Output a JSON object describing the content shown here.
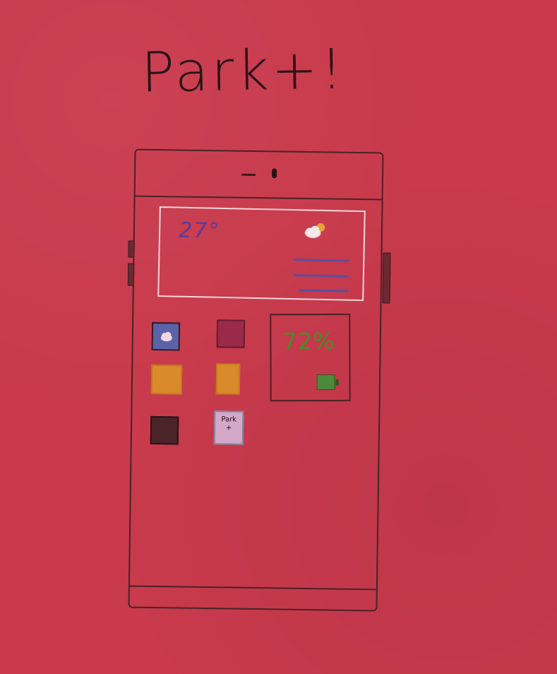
{
  "title": "Park+!",
  "colors": {
    "background": "#c83a4c",
    "ink": "#2a1418",
    "weather_border": "#f1d6d8",
    "temperature_text": "#5a3a9a",
    "battery_text": "#4a8a2a"
  },
  "weather_widget": {
    "temperature": "27°",
    "icon": "sun-cloud-icon",
    "details_lines": 3
  },
  "battery_widget": {
    "percent": "72%",
    "level": 0.72,
    "icon": "battery-icon"
  },
  "apps": [
    {
      "icon": "cloud-icon",
      "color": "#5a63a8"
    },
    {
      "icon": "app-icon",
      "color": "#9a2a4a"
    },
    {
      "icon": "app-icon",
      "color": "#d98a2a"
    },
    {
      "icon": "app-icon",
      "color": "#d98a2a"
    },
    {
      "icon": "app-icon",
      "color": "#4a2428"
    },
    {
      "icon": "park-plus-icon",
      "label_line1": "Park",
      "label_line2": "+"
    }
  ]
}
